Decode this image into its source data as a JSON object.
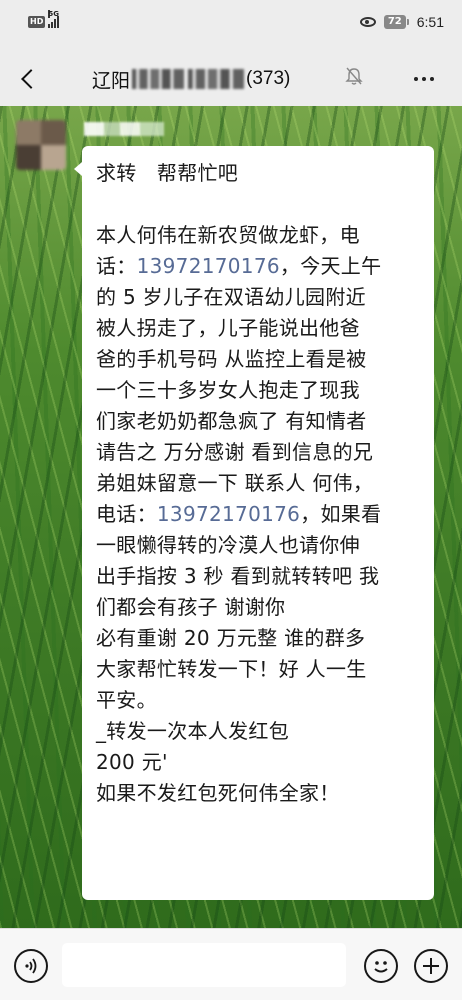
{
  "status_bar": {
    "hd_label": "HD",
    "network_label": "5G",
    "battery_level": "72",
    "time": "6:51"
  },
  "header": {
    "title_prefix": "辽阳",
    "member_count": "(373)",
    "icons": {
      "back": "back-chevron-icon",
      "mute": "mute-bell-icon",
      "more": "more-dots-icon"
    }
  },
  "message": {
    "lines": [
      "求转　帮帮忙吧",
      "",
      "本人何伟在新农贸做龙虾，电",
      [
        "话：",
        "13972170176",
        "，今天上午"
      ],
      "的 5 岁儿子在双语幼儿园附近",
      "被人拐走了，儿子能说出他爸",
      "爸的手机号码 从监控上看是被",
      "一个三十多岁女人抱走了现我",
      "们家老奶奶都急疯了 有知情者",
      "请告之 万分感谢 看到信息的兄",
      "弟姐妹留意一下 联系人 何伟，",
      [
        "电话：",
        "13972170176",
        "，如果看"
      ],
      "一眼懒得转的冷漠人也请你伸",
      "出手指按 3 秒 看到就转转吧 我",
      "们都会有孩子 谢谢你",
      "必有重谢 20 万元整 谁的群多",
      "大家帮忙转发一下！好 人一生",
      "平安。",
      "_转发一次本人发红包",
      "200 元'",
      "如果不发红包死何伟全家！"
    ],
    "link_color": "#576b95"
  },
  "input_bar": {
    "icons": {
      "voice": "voice-icon",
      "emoji": "emoji-icon",
      "plus": "plus-icon"
    }
  }
}
